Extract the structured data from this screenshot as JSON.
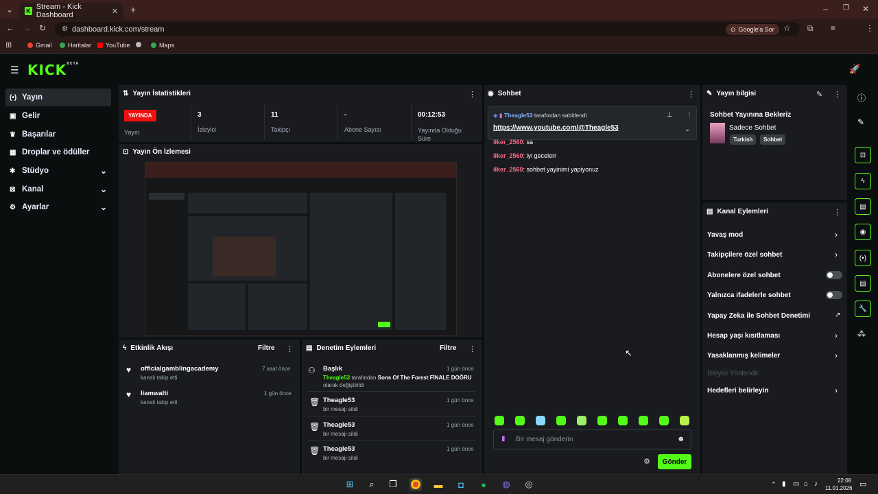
{
  "browser": {
    "tab_title": "Stream - Kick Dashboard",
    "url": "dashboard.kick.com/stream",
    "google_button": "Google'a Sor",
    "bookmarks": [
      "Gmail",
      "Haritalar",
      "YouTube",
      "Maps"
    ]
  },
  "app": {
    "logo": "KICK",
    "logo_badge": "BETA"
  },
  "sidebar": {
    "items": [
      {
        "label": "Yayın",
        "icon": "broadcast-icon",
        "active": true
      },
      {
        "label": "Gelir",
        "icon": "wallet-icon"
      },
      {
        "label": "Başarılar",
        "icon": "trophy-icon"
      },
      {
        "label": "Droplar ve ödüller",
        "icon": "gift-icon"
      },
      {
        "label": "Stüdyo",
        "icon": "studio-icon",
        "expandable": true
      },
      {
        "label": "Kanal",
        "icon": "channel-icon",
        "expandable": true
      },
      {
        "label": "Ayarlar",
        "icon": "gear-icon",
        "expandable": true
      }
    ]
  },
  "stats": {
    "title": "Yayın İstatistikleri",
    "live_badge": "YAYINDA",
    "live_label": "Yayın",
    "viewers_value": "3",
    "viewers_label": "İzleyici",
    "followers_value": "11",
    "followers_label": "Takipçi",
    "subs_value": "-",
    "subs_label": "Abone Sayısı",
    "uptime_value": "00:12:53",
    "uptime_label": "Yayında Olduğu Süre"
  },
  "preview": {
    "title": "Yayın Ön İzlemesi"
  },
  "activity": {
    "title": "Etkinlik Akışı",
    "filter": "Filtre",
    "items": [
      {
        "user": "officialgamblingacademy",
        "desc": "kanalı takip etti",
        "time": "7 saat önce"
      },
      {
        "user": "liamwalti",
        "desc": "kanalı takip etti",
        "time": "1 gün önce"
      }
    ]
  },
  "moderation": {
    "title": "Denetim Eylemleri",
    "filter": "Filtre",
    "items": [
      {
        "title": "Başlık",
        "actor": "Theagle53",
        "mid": " tarafından ",
        "bold": "Sons Of The Forest FİNALE DOĞRU",
        "tail": "olarak değiştirildi",
        "time": "1 gün önce"
      },
      {
        "title": "Theagle53",
        "desc": "bir mesajı sildi",
        "time": "1 gün önce"
      },
      {
        "title": "Theagle53",
        "desc": "bir mesajı sildi",
        "time": "1 gün önce"
      },
      {
        "title": "Theagle53",
        "desc": "bir mesajı sildi",
        "time": "1 gün önce"
      }
    ]
  },
  "chat": {
    "title": "Sohbet",
    "pinned_by": "Theagle53",
    "pinned_suffix": " tarafından sabitlendi",
    "pinned_link": "https://www.youtube.com/@Theagle53",
    "messages": [
      {
        "user": "ilker_2560",
        "text": ": sa"
      },
      {
        "user": "ilker_2560",
        "text": ": iyi gecelerr"
      },
      {
        "user": "ilker_2560",
        "text": ": sohbet yayinimi yapiyonuz"
      }
    ],
    "input_placeholder": "Bir mesaj gönderin",
    "send_label": "Gönder"
  },
  "stream_info": {
    "title": "Yayın bilgisi",
    "heading": "Sohbet Yayınına Bekleriz",
    "category": "Sadece Sohbet",
    "tags": [
      "Turkish",
      "Sohbet"
    ]
  },
  "channel_actions": {
    "title": "Kanal Eylemleri",
    "items": [
      {
        "label": "Yavaş mod",
        "control": "arrow"
      },
      {
        "label": "Takipçilere özel sohbet",
        "control": "arrow"
      },
      {
        "label": "Abonelere özel sohbet",
        "control": "toggle"
      },
      {
        "label": "Yalnızca ifadelerle sohbet",
        "control": "toggle"
      },
      {
        "label": "Yapay Zeka ile Sohbet Denetimi",
        "control": "external"
      },
      {
        "label": "Hesap yaşı kısıtlaması",
        "control": "arrow"
      },
      {
        "label": "Yasaklanmış kelimeler",
        "control": "arrow"
      },
      {
        "label": "İzleyici Yönlendir",
        "control": "none",
        "disabled": true
      },
      {
        "label": "Hedefleri belirleyin",
        "control": "arrow"
      }
    ]
  },
  "taskbar": {
    "time": "22:08",
    "date": "11.01.2026"
  },
  "colors": {
    "accent": "#53fc18",
    "live": "#ee1111",
    "chat_user": "#ff6b8a"
  }
}
